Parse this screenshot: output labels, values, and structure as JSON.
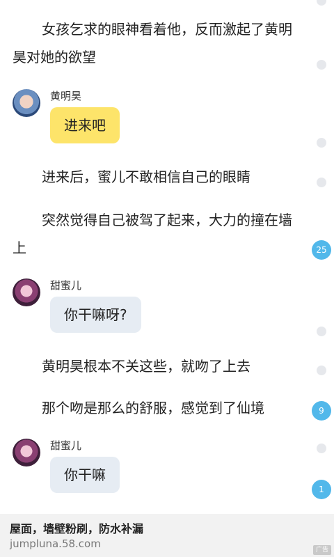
{
  "story": {
    "paragraphs": [
      "女孩乞求的眼神看着他，反而激起了黄明昊对她的欲望",
      "进来后，蜜儿不敢相信自己的眼睛",
      "突然觉得自己被驾了起来，大力的撞在墙上",
      "黄明昊根本不关这些，就吻了上去",
      "那个吻是那么的舒服，感觉到了仙境"
    ],
    "dialogues": [
      {
        "speaker": "黄明昊",
        "text": "进来吧",
        "bubble_color": "#fde46a"
      },
      {
        "speaker": "甜蜜儿",
        "text": "你干嘛呀?",
        "bubble_color": "#e6ecf3"
      },
      {
        "speaker": "甜蜜儿",
        "text": "你干嘛",
        "bubble_color": "#e6ecf3"
      }
    ]
  },
  "comment_counts": [
    "25",
    "9",
    "1"
  ],
  "ad": {
    "title": "屋面，墙壁粉刷，防水补漏",
    "url": "jumpluna.58.com",
    "badge": "广告"
  },
  "colors": {
    "count_badge": "#52b8ea",
    "dot": "#e6e8ec",
    "ad_background": "#f2f2f2"
  }
}
